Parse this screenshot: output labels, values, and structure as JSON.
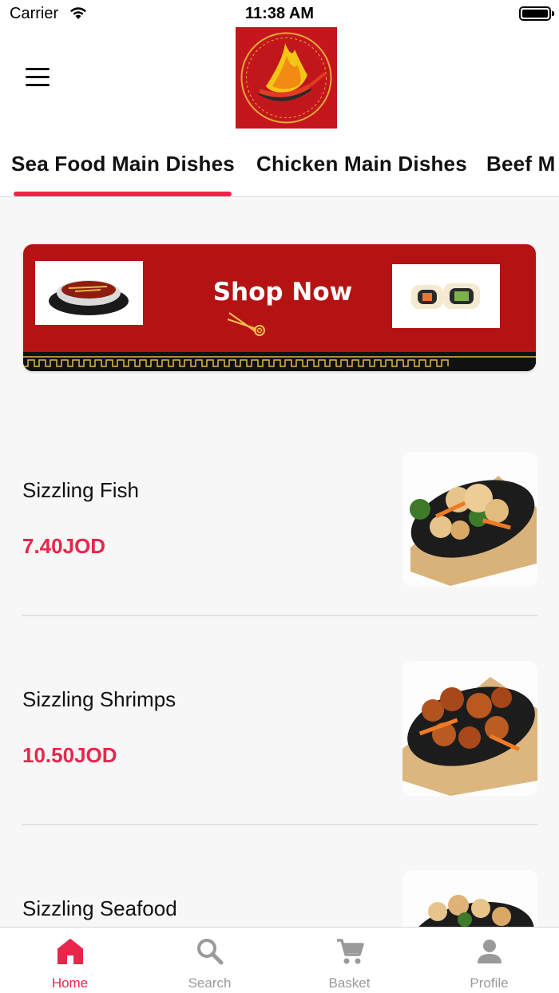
{
  "status_bar": {
    "carrier": "Carrier",
    "time": "11:38 AM"
  },
  "header": {
    "menu_icon": "hamburger-menu-icon",
    "logo": "restaurant-logo-wok-flame"
  },
  "tabs": [
    {
      "label": "Sea Food Main Dishes",
      "active": true
    },
    {
      "label": "Chicken Main Dishes",
      "active": false
    },
    {
      "label": "Beef M",
      "active": false
    }
  ],
  "banner": {
    "text": "Shop Now",
    "background": "#b51313"
  },
  "items": [
    {
      "name": "Sizzling Fish",
      "price": "7.40JOD"
    },
    {
      "name": "Sizzling Shrimps",
      "price": "10.50JOD"
    },
    {
      "name": "Sizzling Seafood"
    }
  ],
  "bottom_nav": [
    {
      "label": "Home",
      "icon": "home-icon",
      "active": true
    },
    {
      "label": "Search",
      "icon": "search-icon",
      "active": false
    },
    {
      "label": "Basket",
      "icon": "cart-icon",
      "active": false
    },
    {
      "label": "Profile",
      "icon": "person-icon",
      "active": false
    }
  ],
  "colors": {
    "accent": "#e8264c",
    "inactive": "#9a9a9a",
    "text": "#111111"
  }
}
